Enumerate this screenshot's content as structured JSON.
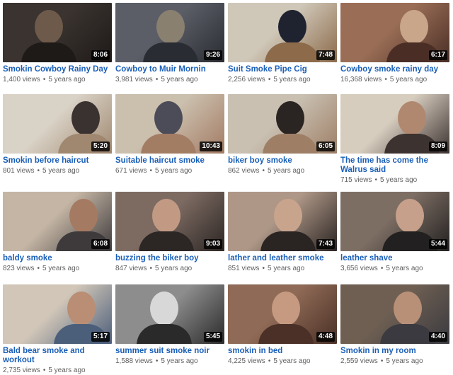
{
  "videos": [
    {
      "title": "Smokin Cowboy Rainy Day",
      "duration": "8:06",
      "views": "1,400 views",
      "age": "5 years ago",
      "colors": [
        "#3a3330",
        "#6d5a4a",
        "#1e1a18"
      ]
    },
    {
      "title": "Cowboy to Muir Mornin",
      "duration": "9:26",
      "views": "3,981 views",
      "age": "5 years ago",
      "colors": [
        "#5b5e66",
        "#8a8070",
        "#2a2c33"
      ]
    },
    {
      "title": "Suit Smoke Pipe Cig",
      "duration": "7:48",
      "views": "2,256 views",
      "age": "5 years ago",
      "colors": [
        "#cfc7b8",
        "#1f2330",
        "#8c6a4a"
      ]
    },
    {
      "title": "Cowboy smoke rainy day",
      "duration": "6:17",
      "views": "16,368 views",
      "age": "5 years ago",
      "colors": [
        "#9a6e56",
        "#c9a58a",
        "#4a2e26"
      ]
    },
    {
      "title": "Smokin before haircut",
      "duration": "5:20",
      "views": "801 views",
      "age": "5 years ago",
      "colors": [
        "#d9d2c6",
        "#3a3230",
        "#a08870"
      ]
    },
    {
      "title": "Suitable haircut smoke",
      "duration": "10:43",
      "views": "671 views",
      "age": "5 years ago",
      "colors": [
        "#cbbfae",
        "#4b4c58",
        "#a37c64"
      ]
    },
    {
      "title": "biker boy smoke",
      "duration": "6:05",
      "views": "862 views",
      "age": "5 years ago",
      "colors": [
        "#c9c0b2",
        "#2a2422",
        "#9e7f66"
      ]
    },
    {
      "title": "The time has come the Walrus said",
      "duration": "8:09",
      "views": "715 views",
      "age": "5 years ago",
      "colors": [
        "#d7cdbf",
        "#b08870",
        "#3c3230"
      ]
    },
    {
      "title": "baldy smoke",
      "duration": "6:08",
      "views": "823 views",
      "age": "5 years ago",
      "colors": [
        "#c4b5a4",
        "#a57a62",
        "#3e3a3c"
      ]
    },
    {
      "title": "buzzing the biker boy",
      "duration": "9:03",
      "views": "847 views",
      "age": "5 years ago",
      "colors": [
        "#7d6b62",
        "#c29a84",
        "#2c2624"
      ]
    },
    {
      "title": "lather and leather smoke",
      "duration": "7:43",
      "views": "851 views",
      "age": "5 years ago",
      "colors": [
        "#ae9787",
        "#c9a48c",
        "#2a2422"
      ]
    },
    {
      "title": "leather shave",
      "duration": "5:44",
      "views": "3,656 views",
      "age": "5 years ago",
      "colors": [
        "#7d6e64",
        "#c6a08a",
        "#222020"
      ]
    },
    {
      "title": "Bald bear smoke and workout",
      "duration": "5:17",
      "views": "2,735 views",
      "age": "5 years ago",
      "colors": [
        "#d1c6b8",
        "#b98e74",
        "#4b5e7a"
      ]
    },
    {
      "title": "summer suit smoke noir",
      "duration": "5:45",
      "views": "1,588 views",
      "age": "5 years ago",
      "colors": [
        "#8d8d8d",
        "#d8d8d8",
        "#2a2a2a"
      ]
    },
    {
      "title": "smokin in bed",
      "duration": "4:48",
      "views": "4,225 views",
      "age": "5 years ago",
      "colors": [
        "#8f6a56",
        "#c59a80",
        "#4a3026"
      ]
    },
    {
      "title": "Smokin in my room",
      "duration": "4:40",
      "views": "2,559 views",
      "age": "5 years ago",
      "colors": [
        "#6e5f52",
        "#b89078",
        "#3a3a40"
      ]
    }
  ]
}
